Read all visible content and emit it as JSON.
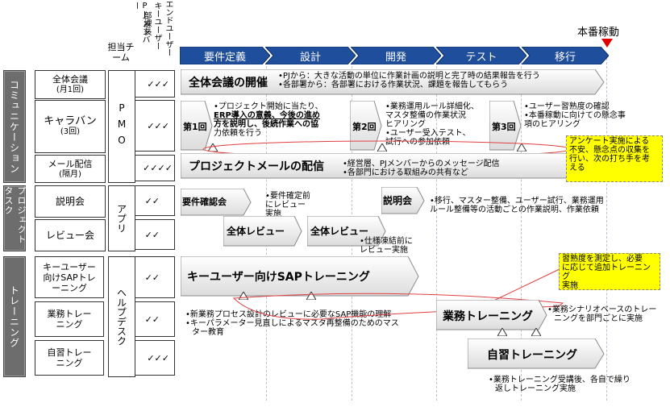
{
  "headers": {
    "tanto": "担当チーム",
    "members": "PJメンバー",
    "bucho": "部課長",
    "keyuser": "キーユーザー",
    "enduser": "エンドユーザー"
  },
  "milestone": "本番稼動",
  "phases": [
    "要件定義",
    "設計",
    "開発",
    "テスト",
    "移行"
  ],
  "categories": {
    "comm": "コミュニケーション",
    "pj": "プロジェクトタスク",
    "train": "トレーニング"
  },
  "rows": [
    {
      "name": "全体会議",
      "sub": "(月1回)",
      "checks": "✓✓✓"
    },
    {
      "name": "キャラバン",
      "sub": "(3回)",
      "checks": "✓✓✓"
    },
    {
      "name": "メール配信",
      "sub": "(隔月)",
      "checks": "✓✓✓✓"
    },
    {
      "name": "説明会",
      "sub": "",
      "checks": "✓✓"
    },
    {
      "name": "レビュー会",
      "sub": "",
      "checks": "✓✓"
    },
    {
      "name": "キーユーザー向けSAPトレーニング",
      "sub": "",
      "checks": "✓✓"
    },
    {
      "name": "業務トレーニング",
      "sub": "",
      "checks": "✓✓"
    },
    {
      "name": "自習トレーニング",
      "sub": "",
      "checks": "✓✓✓"
    }
  ],
  "teams": {
    "pmo": "PMO",
    "app": "アプリ",
    "help": "ヘルプデスク"
  },
  "activities": {
    "zentai": "全体会議の開催",
    "zentai_notes": [
      "•PJから：大きな活動の単位に作業計画の説明と完了時の結果報告を行う",
      "•各部署から：各部署における作業状況、課題を報告してもらう"
    ],
    "r1": "第1回",
    "r2": "第2回",
    "r3": "第3回",
    "c1": [
      "•プロジェクト開始に当たり、",
      "ERP導入の意義、今後の進め",
      "方を説明し、後続作業への協",
      "力依頼を行う"
    ],
    "c2": [
      "•業務運用ルール詳細化、",
      "マスタ整備の作業状況",
      "ヒアリング",
      "•ユーザー受入テスト、",
      "試行への参加依頼"
    ],
    "c3": [
      "•ユーザー習熟度の確認",
      "•本番稼動に向けての懸念事",
      "項のヒアリング"
    ],
    "ank": [
      "アンケート実施による",
      "不安、懸念点の収集を",
      "行い、次の打ち手を考",
      "える"
    ],
    "mail": "プロジェクトメールの配信",
    "mail_notes": [
      "•経営層、PJメンバーからのメッセージ配信",
      "•各部門における取組みの共有など"
    ],
    "yoken": "要件確認会",
    "yoken_notes": [
      "•要件確定前",
      "にレビュー",
      "実施"
    ],
    "setsumei": "説明会",
    "setsumei_notes": [
      "•移行、マスター整備、ユーザー試行、業務運用",
      "ルール整備等の活動ごとの作業説明、作業依頼"
    ],
    "review1": "全体レビュー",
    "review2": "全体レビュー",
    "review_notes": [
      "•仕様凍結前に",
      "レビュー実施"
    ],
    "sap": "キーユーザー向けSAPトレーニング",
    "sap_notes": [
      "•新業務プロセス設計のレビューに必要なSAP機能の理解",
      "•キーパラメーター見直しによるマスタ再整備のためのマス",
      "ター教育"
    ],
    "jyuku": [
      "習熟度を測定し、必要",
      "に応じて追加トレーニング",
      "実施"
    ],
    "gyomu": "業務トレーニング",
    "gyomu_notes": [
      "•業務シナリオベースのトレー",
      "ニングを部門ごとに実施"
    ],
    "jishu": "自習トレーニング",
    "jishu_notes": [
      "•業務トレーニング受講後、各自で繰り",
      "返しトレーニング実施"
    ]
  },
  "colors": {
    "phase": "#1f4e9c",
    "cat": "#6d6d6d",
    "milestone": "#e00000",
    "highlight": "#ffff00",
    "callout": "#e04040"
  }
}
